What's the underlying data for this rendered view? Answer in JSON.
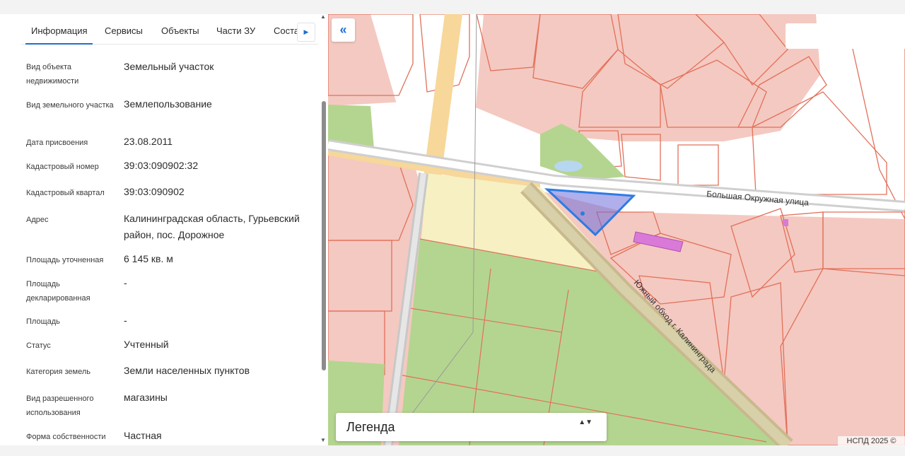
{
  "tabs": [
    {
      "label": "Информация",
      "active": true
    },
    {
      "label": "Сервисы"
    },
    {
      "label": "Объекты"
    },
    {
      "label": "Части ЗУ"
    },
    {
      "label": "Соста"
    }
  ],
  "tab_next_icon": "chevron-right-icon",
  "info_rows": [
    {
      "label": "Вид объекта недвижимости",
      "value": "Земельный участок"
    },
    {
      "label": "Вид земельного участка",
      "value": "Землепользование"
    },
    {
      "label": "Дата присвоения",
      "value": "23.08.2011"
    },
    {
      "label": "Кадастровый номер",
      "value": "39:03:090902:32"
    },
    {
      "label": "Кадастровый квартал",
      "value": "39:03:090902"
    },
    {
      "label": "Адрес",
      "value": "Калининградская область, Гурьевский район, пос. Дорожное"
    },
    {
      "label": "Площадь уточненная",
      "value": "6 145 кв. м"
    },
    {
      "label": "Площадь декларированная",
      "value": "-"
    },
    {
      "label": "Площадь",
      "value": "-"
    },
    {
      "label": "Статус",
      "value": "Учтенный"
    },
    {
      "label": "Категория земель",
      "value": "Земли населенных пунктов"
    },
    {
      "label": "Вид разрешенного использования",
      "value": "магазины"
    },
    {
      "label": "Форма собственности",
      "value": "Частная"
    }
  ],
  "map": {
    "collapse_icon": "«",
    "street_1": "Большая Окружная улица",
    "street_2": "Южный обход г. Калининграда",
    "legend_title": "Легенда",
    "legend_arrows": "▲▼",
    "attribution": "НСПД 2025 ©",
    "colors": {
      "parcel_fill": "#f4c9c1",
      "parcel_line": "#e2705a",
      "green": "#b4d58f",
      "yellow": "#f6f0c3",
      "selected": "#2c7be5",
      "road": "#d9d9d9"
    }
  }
}
